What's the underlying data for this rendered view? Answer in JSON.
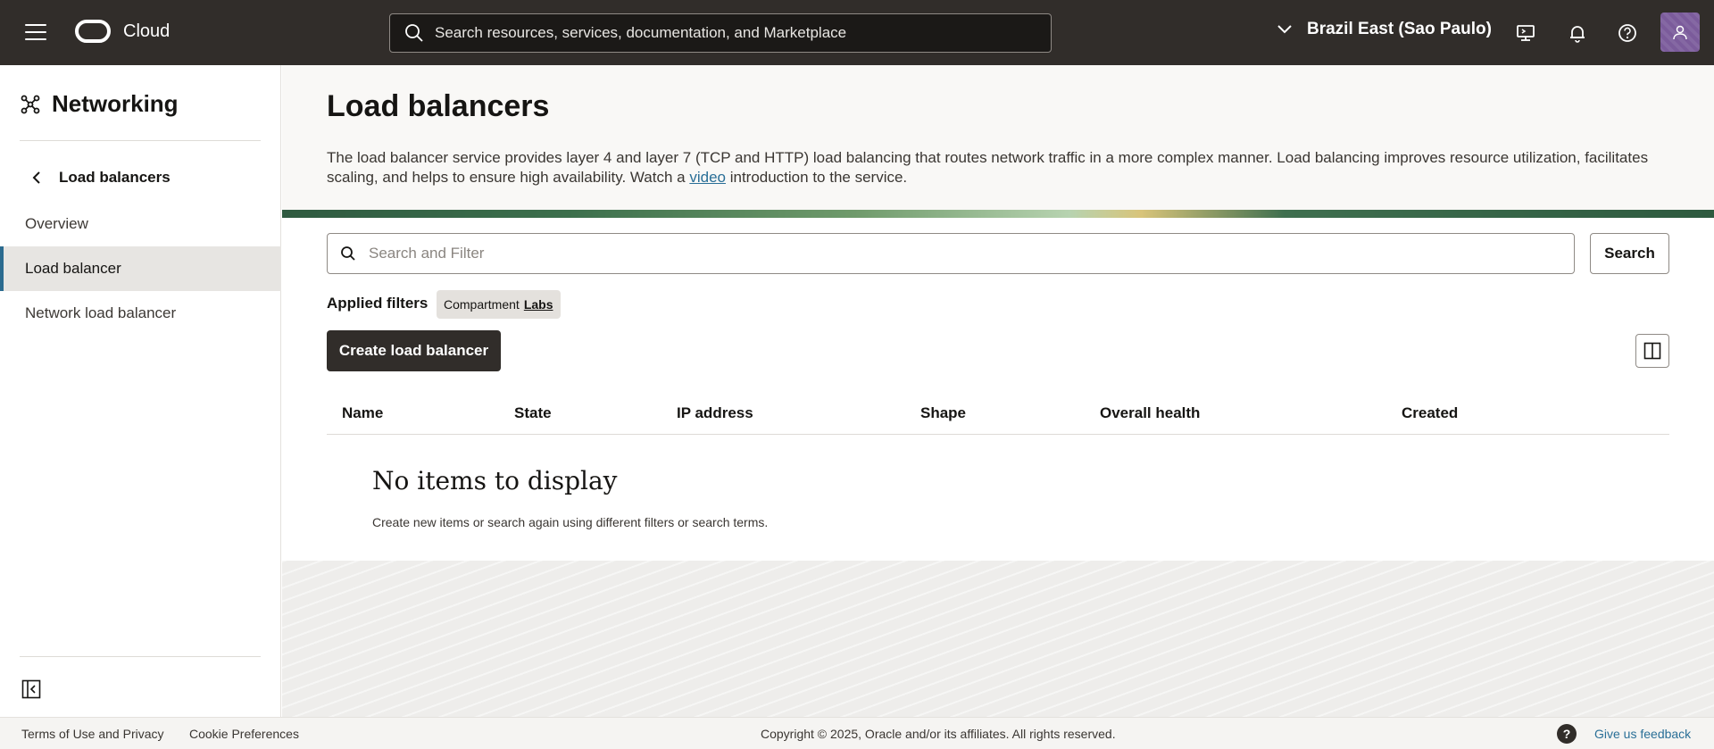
{
  "topbar": {
    "brand": "Cloud",
    "search_placeholder": "Search resources, services, documentation, and Marketplace",
    "region": "Brazil East (Sao Paulo)",
    "icons": [
      "menu-icon",
      "oracle-logo",
      "search-icon",
      "chevron-down-icon",
      "cloud-shell-icon",
      "bell-icon",
      "help-icon",
      "user-avatar-icon"
    ]
  },
  "sidebar": {
    "title": "Networking",
    "back_label": "Load balancers",
    "items": [
      {
        "label": "Overview",
        "active": false
      },
      {
        "label": "Load balancer",
        "active": true
      },
      {
        "label": "Network load balancer",
        "active": false
      }
    ]
  },
  "header": {
    "title": "Load balancers",
    "description_before": "The load balancer service provides layer 4 and layer 7 (TCP and HTTP) load balancing that routes network traffic in a more complex manner. Load balancing improves resource utilization, facilitates scaling, and helps to ensure high availability. Watch a ",
    "video_link": "video",
    "description_after": " introduction to the service."
  },
  "filter": {
    "placeholder": "Search and Filter",
    "search_button": "Search",
    "applied_label": "Applied filters",
    "chip_key": "Compartment",
    "chip_value": "Labs"
  },
  "actions": {
    "create_button": "Create load balancer"
  },
  "table": {
    "columns": [
      "Name",
      "State",
      "IP address",
      "Shape",
      "Overall health",
      "Created"
    ],
    "rows": [],
    "empty_title": "No items to display",
    "empty_subtitle": "Create new items or search again using different filters or search terms."
  },
  "footer": {
    "terms": "Terms of Use and Privacy",
    "cookies": "Cookie Preferences",
    "copyright": "Copyright © 2025, Oracle and/or its affiliates. All rights reserved.",
    "help_glyph": "?",
    "feedback": "Give us feedback"
  },
  "colors": {
    "topbar": "#312d2a",
    "accent_active": "#2b6b8f",
    "link": "#2a6f97",
    "avatar": "#7b5b9b"
  }
}
